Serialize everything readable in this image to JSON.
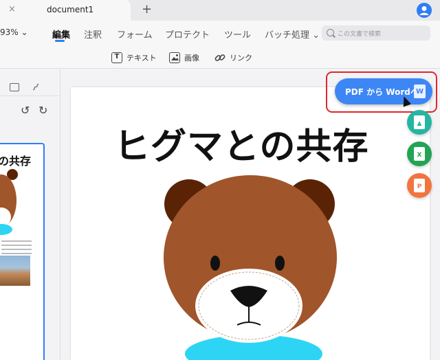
{
  "tabs": {
    "close_symbol": "×",
    "title": "document1",
    "add_symbol": "+"
  },
  "toolbar": {
    "zoom": "93% ⌄",
    "menu": [
      "編集",
      "注釈",
      "フォーム",
      "プロテクト",
      "ツール",
      "バッチ処理 ⌄"
    ],
    "search_placeholder": "この文書で検索",
    "subtools": [
      {
        "label": "テキスト",
        "icon": "text-box-icon",
        "glyph": "T"
      },
      {
        "label": "画像",
        "icon": "image-icon",
        "glyph": ""
      },
      {
        "label": "リンク",
        "icon": "link-icon",
        "glyph": "🔗"
      }
    ]
  },
  "sidebar": {
    "rotate_left": "↺",
    "rotate_right": "↻",
    "thumbnail_title": "の共存"
  },
  "document": {
    "title": "ヒグマとの共存"
  },
  "convert": {
    "word_label": "PDF から Wordへ",
    "word_icon_text": "W",
    "image_icon_text": "▲",
    "excel_icon_text": "X",
    "ppt_icon_text": "P"
  },
  "colors": {
    "accent": "#2f7df6",
    "highlight": "#e0262a",
    "image_fab": "#26b5a3",
    "excel_fab": "#22a454",
    "ppt_fab": "#f2743e",
    "bear_brown": "#a0552a",
    "bear_dark": "#5a2306",
    "bear_collar": "#2ed4f4"
  }
}
